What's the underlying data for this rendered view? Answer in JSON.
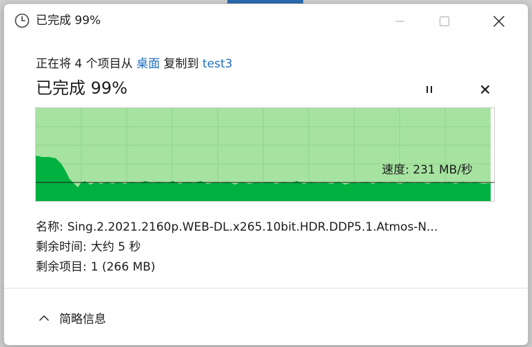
{
  "window": {
    "title": "已完成 99%",
    "controls": {
      "minimize_icon": "minimize-icon",
      "maximize_icon": "maximize-icon",
      "close_icon": "close-icon"
    }
  },
  "copy": {
    "prefix": "正在将 4 个项目从 ",
    "source": "桌面",
    "middle": " 复制到 ",
    "destination": "test3",
    "progress_title": "已完成 99%",
    "progress_percent": 99,
    "pause_icon": "pause-icon",
    "cancel_icon": "cancel-icon"
  },
  "graph": {
    "speed_label": "速度: 231 MB/秒",
    "fill_color": "#00b140",
    "background_color": "#a6e3a1",
    "grid_color": "#8fd68a"
  },
  "details": {
    "name_label": "名称:",
    "name_value": "Sing.2.2021.2160p.WEB-DL.x265.10bit.HDR.DDP5.1.Atmos-N...",
    "time_label": "剩余时间:",
    "time_value": "大约 5 秒",
    "items_label": "剩余项目:",
    "items_value": "1 (266 MB)"
  },
  "footer": {
    "toggle_icon": "chevron-up-icon",
    "toggle_label": "简略信息"
  }
}
